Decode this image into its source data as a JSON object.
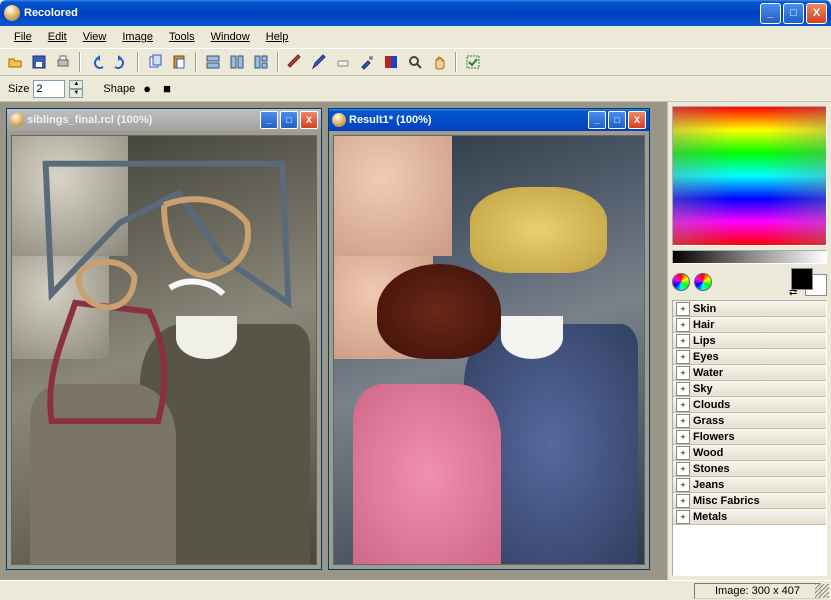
{
  "window": {
    "title": "Recolored"
  },
  "win_buttons": {
    "min": "_",
    "max": "□",
    "close": "X"
  },
  "menu": {
    "file": "File",
    "edit": "Edit",
    "view": "View",
    "image": "Image",
    "tools": "Tools",
    "window": "Window",
    "help": "Help"
  },
  "toolbar_icons": {
    "open": "open-icon",
    "save": "save-icon",
    "print": "print-icon",
    "undo": "undo-icon",
    "redo": "redo-icon",
    "copy": "copy-icon",
    "paste": "paste-icon",
    "tile_h": "tile-horizontal-icon",
    "tile_v": "tile-vertical-icon",
    "cascade": "cascade-icon",
    "brush": "brush-icon",
    "pencil": "pencil-icon",
    "eraser": "eraser-icon",
    "eyedropper": "eyedropper-icon",
    "colorize": "colorize-icon",
    "zoom": "zoom-icon",
    "hand": "hand-icon",
    "marquee": "marquee-icon"
  },
  "options": {
    "size_label": "Size",
    "size_value": "2",
    "shape_label": "Shape",
    "shape_round": "●",
    "shape_square": "■"
  },
  "mdi": {
    "doc1": {
      "title": "siblings_final.rcl (100%)"
    },
    "doc2": {
      "title": "Result1* (100%)"
    }
  },
  "colors": {
    "foreground": "#000000",
    "background": "#ffffff"
  },
  "palette": {
    "items": [
      {
        "label": "Skin"
      },
      {
        "label": "Hair"
      },
      {
        "label": "Lips"
      },
      {
        "label": "Eyes"
      },
      {
        "label": "Water"
      },
      {
        "label": "Sky"
      },
      {
        "label": "Clouds"
      },
      {
        "label": "Grass"
      },
      {
        "label": "Flowers"
      },
      {
        "label": "Wood"
      },
      {
        "label": "Stones"
      },
      {
        "label": "Jeans"
      },
      {
        "label": "Misc Fabrics"
      },
      {
        "label": "Metals"
      }
    ],
    "expand": "+"
  },
  "status": {
    "image_info": "Image: 300 x 407"
  }
}
